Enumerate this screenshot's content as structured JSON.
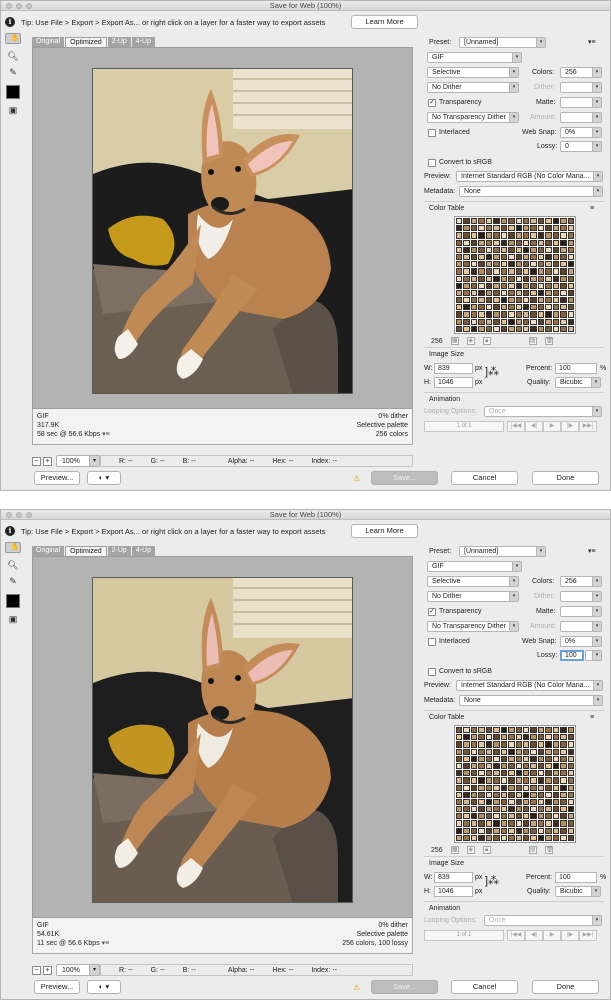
{
  "window_title": "Save for Web (100%)",
  "tip": "Tip: Use File > Export > Export As... or right click on a layer for a faster way to export assets",
  "learn_more": "Learn More",
  "tabs": [
    "Original",
    "Optimized",
    "2-Up",
    "4-Up"
  ],
  "active_tab": "Optimized",
  "zoom": "100%",
  "readouts": {
    "r": "R: --",
    "g": "G: --",
    "b": "B: --",
    "alpha": "Alpha: --",
    "hex": "Hex: --",
    "index": "Index: --"
  },
  "buttons": {
    "preview": "Preview...",
    "save": "Save...",
    "cancel": "Cancel",
    "done": "Done"
  },
  "labels": {
    "preset": "Preset:",
    "colors": "Colors:",
    "dither": "Dither:",
    "transparency": "Transparency",
    "matte": "Matte:",
    "amount": "Amount:",
    "interlaced": "Interlaced",
    "web_snap": "Web Snap:",
    "lossy": "Lossy:",
    "convert_srgb": "Convert to sRGB",
    "preview": "Preview:",
    "metadata": "Metadata:",
    "color_table": "Color Table",
    "image_size": "Image Size",
    "w": "W:",
    "h": "H:",
    "px": "px",
    "percent": "Percent:",
    "pct_sign": "%",
    "quality": "Quality:",
    "animation": "Animation",
    "looping": "Looping Options:"
  },
  "panels": [
    {
      "settings": {
        "preset": "[Unnamed]",
        "format": "GIF",
        "reduction": "Selective",
        "colors": "256",
        "dither_algo": "No Dither",
        "transparency_checked": true,
        "transparency_dither": "No Transparency Dither",
        "interlaced_checked": false,
        "web_snap": "0%",
        "lossy": "0",
        "convert_srgb_checked": false,
        "preview": "Internet Standard RGB (No Color Mana...",
        "metadata": "None",
        "width": "839",
        "height": "1046",
        "percent": "100",
        "quality": "Bicubic",
        "looping": "Once",
        "frame": "1 of 1",
        "color_count": "256"
      },
      "info": {
        "format": "GIF",
        "size": "317.9K",
        "time": "58 sec @ 56.6 Kbps",
        "dither": "0% dither",
        "palette": "Selective palette",
        "colors": "256 colors"
      }
    },
    {
      "settings": {
        "preset": "[Unnamed]",
        "format": "GIF",
        "reduction": "Selective",
        "colors": "256",
        "dither_algo": "No Dither",
        "transparency_checked": true,
        "transparency_dither": "No Transparency Dither",
        "interlaced_checked": false,
        "web_snap": "0%",
        "lossy": "100",
        "convert_srgb_checked": false,
        "preview": "Internet Standard RGB (No Color Mana...",
        "metadata": "None",
        "width": "839",
        "height": "1046",
        "percent": "100",
        "quality": "Bicubic",
        "looping": "Once",
        "frame": "1 of 1",
        "color_count": "256"
      },
      "info": {
        "format": "GIF",
        "size": "54.61K",
        "time": "11 sec @ 56.6 Kbps",
        "dither": "0% dither",
        "palette": "Selective palette",
        "colors": "256 colors, 100 lossy"
      }
    }
  ],
  "palette": [
    "#f4dcc0",
    "#7a5a3a",
    "#c59a6a",
    "#3b2a1c",
    "#e8c08c",
    "#a07040",
    "#d8b890",
    "#5e4028",
    "#f0d8b8",
    "#8a6038",
    "#b8905c",
    "#2a1e14",
    "#e4c8a0",
    "#6e4c2e",
    "#cca47a",
    "#947048"
  ]
}
